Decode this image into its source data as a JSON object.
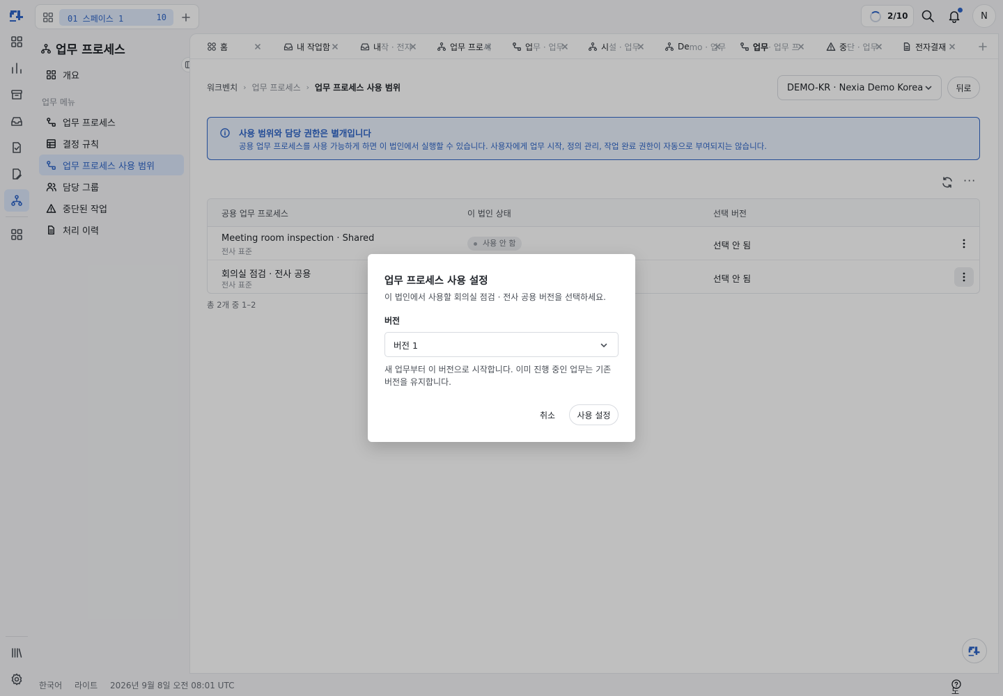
{
  "workspace": {
    "name": "01 스페이스 1",
    "count": "10"
  },
  "topbar": {
    "progress_label": "2/10",
    "avatar_initial": "N"
  },
  "nav": {
    "title": "업무 프로세스",
    "overview": "개요",
    "section_label": "업무 메뉴",
    "items": [
      {
        "label": "업무 프로세스"
      },
      {
        "label": "결정 규칙"
      },
      {
        "label": "업무 프로세스 사용 범위"
      },
      {
        "label": "담당 그룹"
      },
      {
        "label": "중단된 작업"
      },
      {
        "label": "처리 이력"
      }
    ]
  },
  "tabs": [
    {
      "label": "홈",
      "faded": ""
    },
    {
      "label": "내 작업함",
      "faded": ""
    },
    {
      "label": "내 ",
      "faded": "작 · 전자"
    },
    {
      "label": "업무 프로",
      "faded": "세"
    },
    {
      "label": "업",
      "faded": "무 · 업무"
    },
    {
      "label": "시",
      "faded": "설 · 업무"
    },
    {
      "label": "De",
      "faded": "mo · 업무"
    },
    {
      "label": "업무",
      "faded": " · 업무 프"
    },
    {
      "label": "중",
      "faded": "단 · 업무"
    },
    {
      "label": "전자결재",
      "faded": ""
    }
  ],
  "breadcrumb": {
    "root": "워크벤치",
    "mid": "업무 프로세스",
    "current": "업무 프로세스 사용 범위"
  },
  "corp_select": {
    "value": "DEMO-KR · Nexia Demo Korea"
  },
  "back_label": "뒤로",
  "banner": {
    "title": "사용 범위와 담당 권한은 별개입니다",
    "body": "공용 업무 프로세스를 사용 가능하게 하면 이 법인에서 실행할 수 있습니다. 사용자에게 업무 시작, 정의 관리, 작업 완료 권한이 자동으로 부여되지는 않습니다."
  },
  "table": {
    "headers": [
      "공용 업무 프로세스",
      "이 법인 상태",
      "선택 버전"
    ],
    "rows": [
      {
        "name": "Meeting room inspection · Shared",
        "sub": "전사 표준",
        "status": "사용 안 함",
        "version": "선택 안 됨"
      },
      {
        "name": "회의실 점검 · 전사 공용",
        "sub": "전사 표준",
        "status": "",
        "version": "선택 안 됨"
      }
    ],
    "count": "총 2개 중 1–2"
  },
  "footer": {
    "lang": "한국어",
    "theme": "라이트",
    "time": "2026년 9월 8일 오전 08:01 UTC",
    "help": "도움말"
  },
  "modal": {
    "title": "업무 프로세스 사용 설정",
    "desc": "이 법인에서 사용할 회의실 점검 · 전사 공용 버전을 선택하세요.",
    "field_label": "버전",
    "select_value": "버전 1",
    "hint": "새 업무부터 이 버전으로 시작합니다. 이미 진행 중인 업무는 기존 버전을 유지합니다.",
    "cancel": "취소",
    "confirm": "사용 설정"
  },
  "colors": {
    "accent": "#2f66c9",
    "accent_bg": "#dbe7fb"
  }
}
